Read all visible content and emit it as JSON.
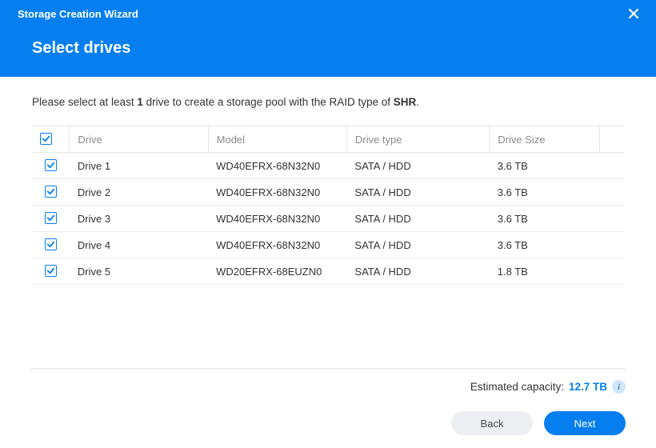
{
  "header": {
    "wizard_title": "Storage Creation Wizard",
    "page_title": "Select drives"
  },
  "instruction": {
    "prefix": "Please select at least ",
    "min_count": "1",
    "middle": " drive to create a storage pool with the RAID type of ",
    "raid_type": "SHR",
    "suffix": "."
  },
  "table": {
    "headers": {
      "drive": "Drive",
      "model": "Model",
      "type": "Drive type",
      "size": "Drive Size"
    },
    "rows": [
      {
        "checked": true,
        "drive": "Drive 1",
        "model": "WD40EFRX-68N32N0",
        "type": "SATA / HDD",
        "size": "3.6 TB"
      },
      {
        "checked": true,
        "drive": "Drive 2",
        "model": "WD40EFRX-68N32N0",
        "type": "SATA / HDD",
        "size": "3.6 TB"
      },
      {
        "checked": true,
        "drive": "Drive 3",
        "model": "WD40EFRX-68N32N0",
        "type": "SATA / HDD",
        "size": "3.6 TB"
      },
      {
        "checked": true,
        "drive": "Drive 4",
        "model": "WD40EFRX-68N32N0",
        "type": "SATA / HDD",
        "size": "3.6 TB"
      },
      {
        "checked": true,
        "drive": "Drive 5",
        "model": "WD20EFRX-68EUZN0",
        "type": "SATA / HDD",
        "size": "1.8 TB"
      }
    ],
    "select_all_checked": true
  },
  "footer": {
    "capacity_label": "Estimated capacity:",
    "capacity_value": "12.7 TB",
    "info_glyph": "i",
    "back_label": "Back",
    "next_label": "Next"
  }
}
